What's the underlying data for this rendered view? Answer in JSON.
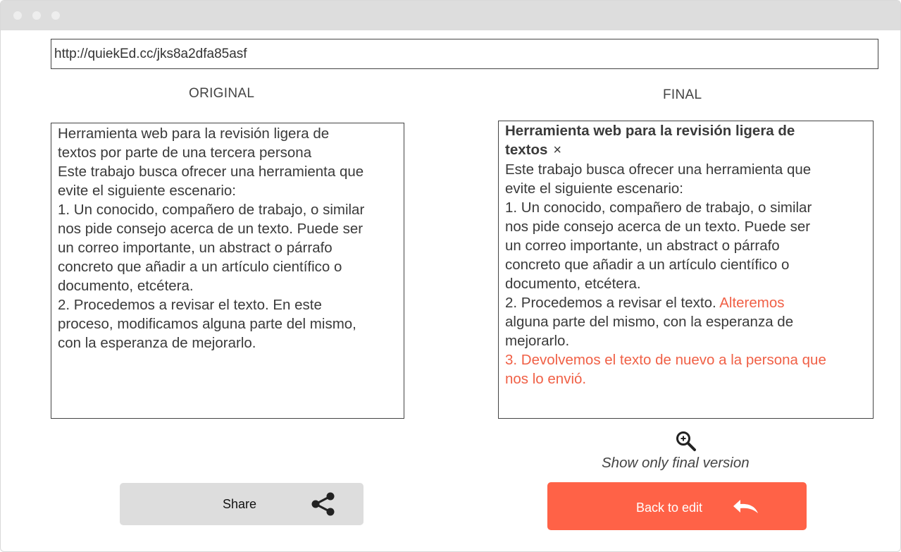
{
  "window": {
    "controls": [
      "close",
      "minimize",
      "maximize"
    ]
  },
  "url_bar": {
    "value": "http://quiekEd.cc/jks8a2dfa85asf"
  },
  "original": {
    "title": "ORIGINAL",
    "lines": [
      "Herramienta web para la revisión ligera de",
      "textos por parte de una tercera persona",
      "Este trabajo busca ofrecer una herramienta que",
      "evite el siguiente escenario:",
      "1. Un conocido, compañero de trabajo, o similar",
      "nos pide consejo acerca de un texto. Puede ser",
      "un correo importante, un abstract o párrafo",
      "concreto que añadir a un artículo científico o",
      "documento, etcétera.",
      "2. Procedemos a revisar el texto. En este",
      "proceso, modificamos alguna parte del mismo,",
      "con la esperanza de mejorarlo."
    ]
  },
  "final": {
    "title": "FINAL",
    "heading_line1": "Herramienta web para la revisión ligera de",
    "heading_line2": "textos",
    "close_symbol": "×",
    "line_3": "Este trabajo busca ofrecer una herramienta que",
    "line_4": "evite el siguiente escenario:",
    "line_5": "1. Un conocido, compañero de trabajo, o similar",
    "line_6": "nos pide consejo acerca de un texto. Puede ser",
    "line_7": "un correo importante, un abstract o párrafo",
    "line_8": "concreto que añadir a un artículo científico o",
    "line_9": "documento, etcétera.",
    "line_10_plain": "2. Procedemos a revisar el texto. ",
    "line_10_edit": "Alteremos",
    "line_11": "alguna parte del mismo, con la esperanza de",
    "line_12": "mejorarlo.",
    "line_13_edit": "3. Devolvemos el texto de nuevo a la persona que",
    "line_14_edit": "nos lo envió."
  },
  "show_final": {
    "label": "Show only final version",
    "icon": "zoom-in-icon"
  },
  "share_button": {
    "label": "Share",
    "icon": "share-icon"
  },
  "back_button": {
    "label": "Back to edit",
    "icon": "undo-icon"
  },
  "colors": {
    "accent": "#ff6247",
    "edit_text": "#f06046",
    "share_bg": "#dddddd",
    "titlebar": "#dddddd"
  }
}
